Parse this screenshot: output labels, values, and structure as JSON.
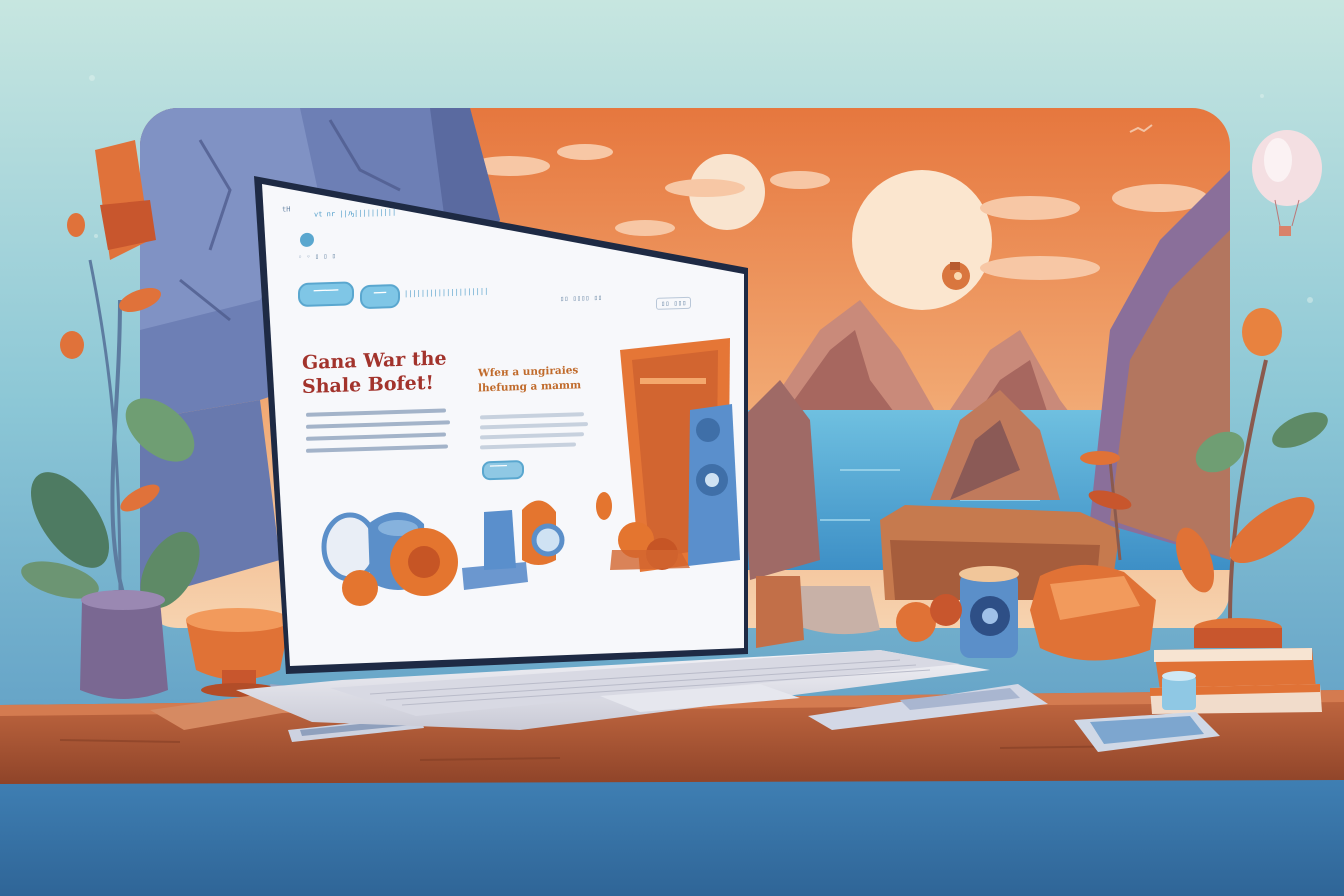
{
  "scene": {
    "palette": {
      "sky_top": "#bfe3df",
      "sky_bottom": "#5a9ec7",
      "sunset_top": "#e9834b",
      "sunset_bottom": "#f5c8a0",
      "rock": "#6f7fb0",
      "desk": "#b45a38",
      "laptop_frame": "#eeeef3",
      "screen_bg": "#f7f8fb",
      "accent_orange": "#e4752f",
      "accent_blue": "#5b8fc9",
      "plant_green": "#5d8a69"
    },
    "icons": [
      "laptop-icon",
      "potted-plant-icon",
      "hot-air-balloon-icon",
      "book-stack-icon",
      "phone-icon",
      "cup-icon",
      "pot-icon",
      "speaker-icon",
      "keyboard-icon",
      "sun-icon",
      "cloud-icon",
      "mountain-icon",
      "lake-icon"
    ]
  },
  "screen": {
    "topbar": {
      "left": "tH",
      "tabs": "vt   nr  ||ԡ||||||||||"
    },
    "nav": {
      "btn1": "▔▔▔▔",
      "btn2": "▔▔",
      "link": "||||||||||||||||||||",
      "right_links": "▯▯  ▯▯▯▯  ▯▯",
      "search": "▯▯ ▯▯▯"
    },
    "hero_title_line1": "Gana War the",
    "hero_title_line2": "Shale Bofet!",
    "hero_sub_line1": "Wfeн a ungiraies",
    "hero_sub_line2": "lhefumg a mamm",
    "cta": "▔▔▔▔"
  }
}
